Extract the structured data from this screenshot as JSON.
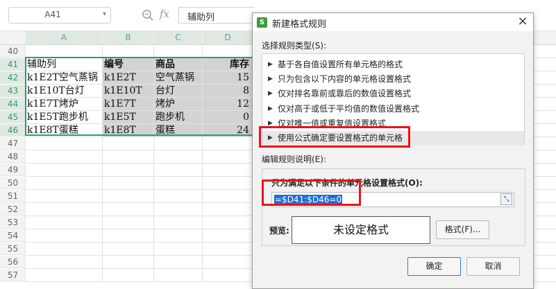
{
  "formula_bar": {
    "name_box": "A41",
    "fx": "fx",
    "content": "辅助列"
  },
  "sheet": {
    "columns": [
      "A",
      "B",
      "C",
      "D"
    ],
    "rows": [
      {
        "n": "40",
        "cells": [
          "",
          "",
          "",
          ""
        ]
      },
      {
        "n": "41",
        "cells": [
          "辅助列",
          "编号",
          "商品",
          "库存"
        ]
      },
      {
        "n": "42",
        "cells": [
          "k1E2T空气蒸锅",
          "k1E2T",
          "空气蒸锅",
          "15"
        ]
      },
      {
        "n": "43",
        "cells": [
          "k1E10T台灯",
          "k1E10T",
          "台灯",
          "8"
        ]
      },
      {
        "n": "44",
        "cells": [
          "k1E7T烤炉",
          "k1E7T",
          "烤炉",
          "12"
        ]
      },
      {
        "n": "45",
        "cells": [
          "k1E5T跑步机",
          "k1E5T",
          "跑步机",
          "0"
        ]
      },
      {
        "n": "46",
        "cells": [
          "k1E8T蛋糕",
          "k1E8T",
          "蛋糕",
          "24"
        ]
      },
      {
        "n": "47"
      },
      {
        "n": "48"
      },
      {
        "n": "49"
      },
      {
        "n": "50"
      },
      {
        "n": "51"
      },
      {
        "n": "52"
      },
      {
        "n": "53"
      },
      {
        "n": "54"
      },
      {
        "n": "55"
      },
      {
        "n": "56"
      },
      {
        "n": "57"
      }
    ]
  },
  "dialog": {
    "title": "新建格式规则",
    "icon_letter": "S",
    "close": "×",
    "select_type_label": "选择规则类型(S):",
    "rule_types": [
      "基于各自值设置所有单元格的格式",
      "只为包含以下内容的单元格设置格式",
      "仅对排名靠前或靠后的数值设置格式",
      "仅对高于或低于平均值的数值设置格式",
      "仅对唯一值或重复值设置格式",
      "使用公式确定要设置格式的单元格"
    ],
    "selected_index": 5,
    "edit_label": "编辑规则说明(E):",
    "condition_label": "只为满足以下条件的单元格设置格式(O):",
    "formula": "=$D41:$D46=0",
    "preview_label": "预览:",
    "preview_text": "未设定格式",
    "format_button": "格式(F)...",
    "ok_button": "确定",
    "cancel_button": "取消"
  },
  "colors": {
    "selection_border": "#1fa463",
    "highlight": "#e8141a",
    "accent": "#2d7ad6"
  }
}
